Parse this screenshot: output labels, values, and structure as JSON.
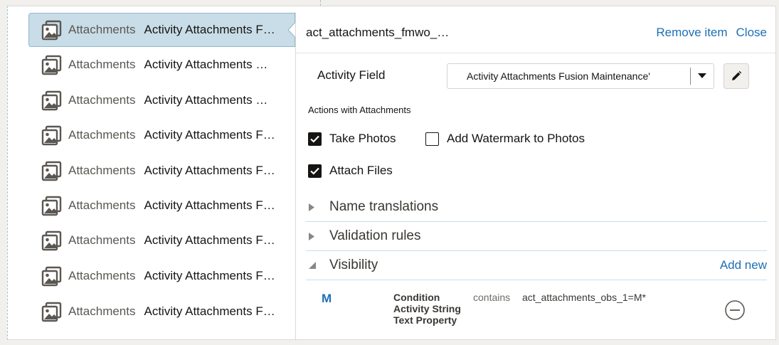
{
  "list": {
    "items": [
      {
        "type": "Attachments",
        "name": "Activity Attachments F…",
        "selected": true
      },
      {
        "type": "Attachments",
        "name": "Activity Attachments …"
      },
      {
        "type": "Attachments",
        "name": "Activity Attachments …"
      },
      {
        "type": "Attachments",
        "name": "Activity Attachments F…"
      },
      {
        "type": "Attachments",
        "name": "Activity Attachments F…"
      },
      {
        "type": "Attachments",
        "name": "Activity Attachments F…"
      },
      {
        "type": "Attachments",
        "name": "Activity Attachments F…"
      },
      {
        "type": "Attachments",
        "name": "Activity Attachments F…"
      },
      {
        "type": "Attachments",
        "name": "Activity Attachments F…"
      }
    ]
  },
  "panel": {
    "key": "act_attachments_fmwo_…",
    "remove_label": "Remove item",
    "close_label": "Close",
    "field_label": "Activity Field",
    "field_value": "Activity Attachments Fusion Maintenance'",
    "actions_label": "Actions with Attachments",
    "take_photos": {
      "label": "Take Photos",
      "checked": true
    },
    "add_watermark": {
      "label": "Add Watermark to Photos",
      "checked": false
    },
    "attach_files": {
      "label": "Attach Files",
      "checked": true
    },
    "sections": {
      "name_translations": "Name translations",
      "validation_rules": "Validation rules",
      "visibility": "Visibility",
      "add_new": "Add new"
    },
    "visibility_rule": {
      "key": "M",
      "condition_line1": "Condition",
      "condition_line2": "Activity String",
      "condition_line3": "Text Property",
      "operator": "contains",
      "value": "act_attachments_obs_1=M*"
    }
  },
  "colors": {
    "accent": "#1d6fb5",
    "selected_row": "#c9dde8",
    "text": "#161513"
  }
}
